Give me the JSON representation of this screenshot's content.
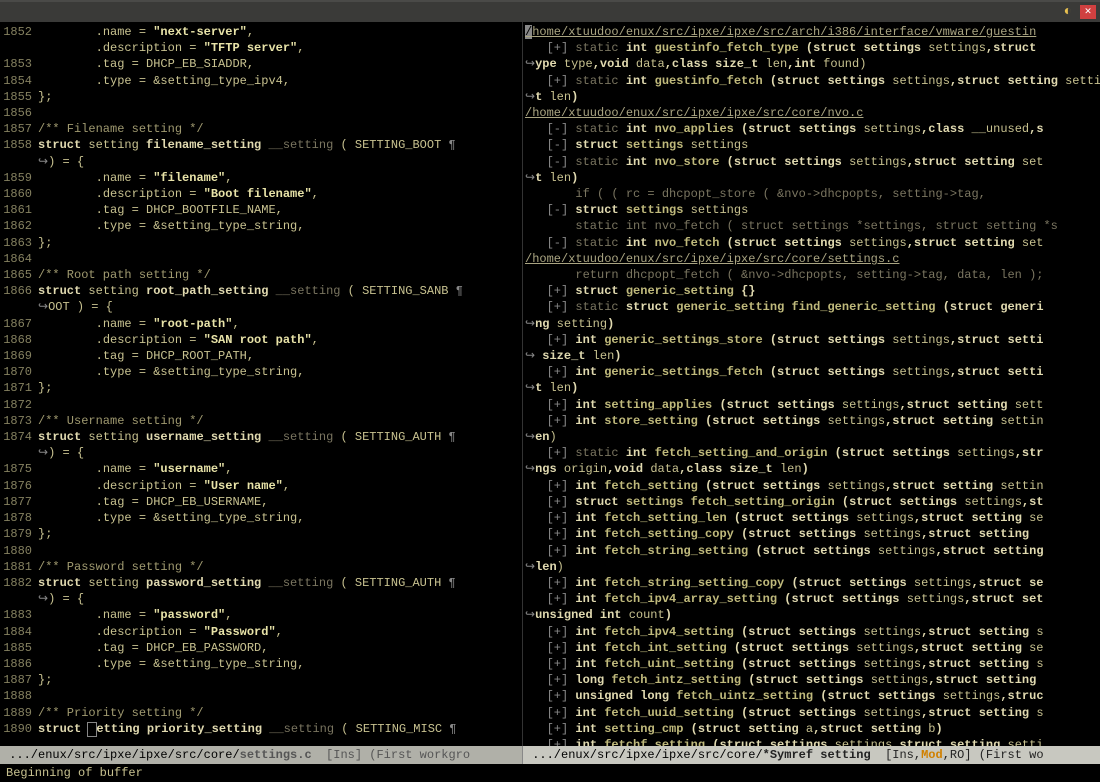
{
  "titlebar": {
    "collapse_glyph": "◐",
    "close_glyph": "✕"
  },
  "left": {
    "lines": [
      {
        "n": "1852",
        "pre": "        .",
        "f": "name",
        "eq": " = ",
        "s": "\"next-server\"",
        "t": ","
      },
      {
        "n": "",
        "pre": "        .",
        "f": "description",
        "eq": " = ",
        "s": "\"TFTP server\"",
        "t": ","
      },
      {
        "n": "1853",
        "pre": "        .",
        "f": "tag",
        "eq": " = DHCP_EB_SIADDR,",
        "s": "",
        "t": ""
      },
      {
        "n": "1854",
        "pre": "        .",
        "f": "type",
        "eq": " = &setting_type_ipv4,",
        "s": "",
        "t": ""
      },
      {
        "n": "1855",
        "pre": "};",
        "f": "",
        "eq": "",
        "s": "",
        "t": ""
      },
      {
        "n": "1856",
        "pre": "",
        "f": "",
        "eq": "",
        "s": "",
        "t": ""
      },
      {
        "n": "1857",
        "pre": "",
        "cm": "/** Filename setting */"
      },
      {
        "n": "1858",
        "struct": true,
        "name": "filename_setting",
        "attr": "__setting",
        "macro": "SETTING_BOOT",
        "wrap": true
      },
      {
        "n": "1859",
        "pre": "        .",
        "f": "name",
        "eq": " = ",
        "s": "\"filename\"",
        "t": ","
      },
      {
        "n": "1860",
        "pre": "        .",
        "f": "description",
        "eq": " = ",
        "s": "\"Boot filename\"",
        "t": ","
      },
      {
        "n": "1861",
        "pre": "        .",
        "f": "tag",
        "eq": " = DHCP_BOOTFILE_NAME,",
        "s": "",
        "t": ""
      },
      {
        "n": "1862",
        "pre": "        .",
        "f": "type",
        "eq": " = &setting_type_string,",
        "s": "",
        "t": ""
      },
      {
        "n": "1863",
        "pre": "};",
        "f": "",
        "eq": "",
        "s": "",
        "t": ""
      },
      {
        "n": "1864",
        "pre": "",
        "f": "",
        "eq": "",
        "s": "",
        "t": ""
      },
      {
        "n": "1865",
        "pre": "",
        "cm": "/** Root path setting */"
      },
      {
        "n": "1866",
        "struct": true,
        "name": "root_path_setting",
        "attr": "__setting",
        "macro": "SETTING_SANB",
        "wrap": true,
        "wrapText": "OOT ) = {"
      },
      {
        "n": "1867",
        "pre": "        .",
        "f": "name",
        "eq": " = ",
        "s": "\"root-path\"",
        "t": ","
      },
      {
        "n": "1868",
        "pre": "        .",
        "f": "description",
        "eq": " = ",
        "s": "\"SAN root path\"",
        "t": ","
      },
      {
        "n": "1869",
        "pre": "        .",
        "f": "tag",
        "eq": " = DHCP_ROOT_PATH,",
        "s": "",
        "t": ""
      },
      {
        "n": "1870",
        "pre": "        .",
        "f": "type",
        "eq": " = &setting_type_string,",
        "s": "",
        "t": ""
      },
      {
        "n": "1871",
        "pre": "};",
        "f": "",
        "eq": "",
        "s": "",
        "t": ""
      },
      {
        "n": "1872",
        "pre": "",
        "f": "",
        "eq": "",
        "s": "",
        "t": ""
      },
      {
        "n": "1873",
        "pre": "",
        "cm": "/** Username setting */"
      },
      {
        "n": "1874",
        "struct": true,
        "name": "username_setting",
        "attr": "__setting",
        "macro": "SETTING_AUTH",
        "wrap": true
      },
      {
        "n": "1875",
        "pre": "        .",
        "f": "name",
        "eq": " = ",
        "s": "\"username\"",
        "t": ","
      },
      {
        "n": "1876",
        "pre": "        .",
        "f": "description",
        "eq": " = ",
        "s": "\"User name\"",
        "t": ","
      },
      {
        "n": "1877",
        "pre": "        .",
        "f": "tag",
        "eq": " = DHCP_EB_USERNAME,",
        "s": "",
        "t": ""
      },
      {
        "n": "1878",
        "pre": "        .",
        "f": "type",
        "eq": " = &setting_type_string,",
        "s": "",
        "t": ""
      },
      {
        "n": "1879",
        "pre": "};",
        "f": "",
        "eq": "",
        "s": "",
        "t": ""
      },
      {
        "n": "1880",
        "pre": "",
        "f": "",
        "eq": "",
        "s": "",
        "t": ""
      },
      {
        "n": "1881",
        "pre": "",
        "cm": "/** Password setting */"
      },
      {
        "n": "1882",
        "struct": true,
        "name": "password_setting",
        "attr": "__setting",
        "macro": "SETTING_AUTH",
        "wrap": true
      },
      {
        "n": "1883",
        "pre": "        .",
        "f": "name",
        "eq": " = ",
        "s": "\"password\"",
        "t": ","
      },
      {
        "n": "1884",
        "pre": "        .",
        "f": "description",
        "eq": " = ",
        "s": "\"Password\"",
        "t": ","
      },
      {
        "n": "1885",
        "pre": "        .",
        "f": "tag",
        "eq": " = DHCP_EB_PASSWORD,",
        "s": "",
        "t": ""
      },
      {
        "n": "1886",
        "pre": "        .",
        "f": "type",
        "eq": " = &setting_type_string,",
        "s": "",
        "t": ""
      },
      {
        "n": "1887",
        "pre": "};",
        "f": "",
        "eq": "",
        "s": "",
        "t": ""
      },
      {
        "n": "1888",
        "pre": "",
        "f": "",
        "eq": "",
        "s": "",
        "t": ""
      },
      {
        "n": "1889",
        "pre": "",
        "cm": "/** Priority setting */"
      },
      {
        "n": "1890",
        "struct": true,
        "name": "priority_setting",
        "attr": "__setting",
        "macro": "SETTING_MISC",
        "wrap": false,
        "cursor": true
      }
    ]
  },
  "right": {
    "paths": [
      {
        "at": 0,
        "text": "/home/xtuudoo/enux/src/ipxe/ipxe/src/arch/i386/interface/vmware/guestin",
        "cursor": true
      },
      {
        "at": 5,
        "text": "/home/xtuudoo/enux/src/ipxe/ipxe/src/core/nvo.c"
      },
      {
        "at": 14,
        "text": "/home/xtuudoo/enux/src/ipxe/ipxe/src/core/settings.c"
      }
    ],
    "rows": [
      {
        "m": "[+]",
        "p": " static ",
        "k": "int",
        "fn": " guestinfo_fetch_type ",
        "a": "(struct settings ",
        "v": "settings",
        "a2": ",struct "
      },
      {
        "wrap": true,
        "p": "ype ",
        "v": "type",
        "p2": ",void ",
        "v2": "data",
        "p3": ",class size_t ",
        "v3": "len",
        "p4": ",int ",
        "v4": "found",
        "p5": ")"
      },
      {
        "m": "[+]",
        "p": " static ",
        "k": "int",
        "fn": " guestinfo_fetch ",
        "a": "(struct settings ",
        "v": "settings",
        "a2": ",struct setting ",
        "v2": "settin"
      },
      {
        "wrap": true,
        "p": "t ",
        "v": "len",
        "p2": ")"
      },
      {
        "m": "[-]",
        "p": " static ",
        "k": "int",
        "fn": " nvo_applies ",
        "a": "(struct settings ",
        "v": "settings",
        "a2": ",class ",
        "v2": "__unused",
        "a3": ",s"
      },
      {
        "m": "[-]",
        "p": " ",
        "k": "struct",
        "fn": " settings ",
        "v": "settings"
      },
      {
        "m": "[-]",
        "p": " static ",
        "k": "int",
        "fn": " nvo_store ",
        "a": "(struct settings ",
        "v": "settings",
        "a2": ",struct setting ",
        "v2": "set"
      },
      {
        "wrap": true,
        "p": "t ",
        "v": "len",
        "p2": ")"
      },
      {
        "plain": true,
        "text": "       if ( ( rc = dhcpopt_store ( &nvo->dhcpopts, setting->tag,"
      },
      {
        "m": "[-]",
        "p": " ",
        "k": "struct",
        "fn": " settings ",
        "v": "settings"
      },
      {
        "plain": true,
        "text": "       static int nvo_fetch ( struct settings *settings, struct setting *s"
      },
      {
        "m": "[-]",
        "p": " static ",
        "k": "int",
        "fn": " nvo_fetch ",
        "a": "(struct settings ",
        "v": "settings",
        "a2": ",struct setting ",
        "v2": "set"
      },
      {
        "plain": true,
        "text": "       return dhcpopt_fetch ( &nvo->dhcpopts, setting->tag, data, len );"
      },
      {
        "m": "[+]",
        "p": " ",
        "k": "struct",
        "fn": " generic_setting ",
        "a": "{}"
      },
      {
        "m": "[+]",
        "p": " static ",
        "k": "struct",
        "fn": " generic_setting ",
        "fn2": "find_generic_setting ",
        "a": "(struct generi"
      },
      {
        "wrap": true,
        "p": "ng ",
        "v": "setting",
        "p2": ")"
      },
      {
        "m": "[+]",
        "p": " ",
        "k": "int",
        "fn": " generic_settings_store ",
        "a": "(struct settings ",
        "v": "settings",
        "a2": ",struct setti"
      },
      {
        "wrap": true,
        "p": " size_t ",
        "v": "len",
        "p2": ")"
      },
      {
        "m": "[+]",
        "p": " ",
        "k": "int",
        "fn": " generic_settings_fetch ",
        "a": "(struct settings ",
        "v": "settings",
        "a2": ",struct setti"
      },
      {
        "wrap": true,
        "p": "t ",
        "v": "len",
        "p2": ")"
      },
      {
        "m": "[+]",
        "p": " ",
        "k": "int",
        "fn": " setting_applies ",
        "a": "(struct settings ",
        "v": "settings",
        "a2": ",struct setting ",
        "v2": "sett"
      },
      {
        "m": "[+]",
        "p": " ",
        "k": "int",
        "fn": " store_setting ",
        "a": "(struct settings ",
        "v": "settings",
        "a2": ",struct setting ",
        "v2": "settin"
      },
      {
        "wrap": true,
        "p": "en",
        ")": true
      },
      {
        "m": "[+]",
        "p": " static ",
        "k": "int",
        "fn": " fetch_setting_and_origin ",
        "a": "(struct settings ",
        "v": "settings",
        "a2": ",str"
      },
      {
        "wrap": true,
        "p": "ngs ",
        "v": "origin",
        "p2": ",void ",
        "v2": "data",
        "p3": ",class size_t ",
        "v3": "len",
        "p4": ")"
      },
      {
        "m": "[+]",
        "p": " ",
        "k": "int",
        "fn": " fetch_setting ",
        "a": "(struct settings ",
        "v": "settings",
        "a2": ",struct setting ",
        "v2": "settin"
      },
      {
        "m": "[+]",
        "p": " ",
        "k": "struct",
        "fn": " settings ",
        "fn2": "fetch_setting_origin ",
        "a": "(struct settings ",
        "v": "settings",
        "a2": ",st"
      },
      {
        "m": "[+]",
        "p": " ",
        "k": "int",
        "fn": " fetch_setting_len ",
        "a": "(struct settings ",
        "v": "settings",
        "a2": ",struct setting ",
        "v2": "se"
      },
      {
        "m": "[+]",
        "p": " ",
        "k": "int",
        "fn": " fetch_setting_copy ",
        "a": "(struct settings ",
        "v": "settings",
        "a2": ",struct setting "
      },
      {
        "m": "[+]",
        "p": " ",
        "k": "int",
        "fn": " fetch_string_setting ",
        "a": "(struct settings ",
        "v": "settings",
        "a2": ",struct setting"
      },
      {
        "wrap": true,
        "p": "len",
        ")": true
      },
      {
        "m": "[+]",
        "p": " ",
        "k": "int",
        "fn": " fetch_string_setting_copy ",
        "a": "(struct settings ",
        "v": "settings",
        "a2": ",struct se"
      },
      {
        "m": "[+]",
        "p": " ",
        "k": "int",
        "fn": " fetch_ipv4_array_setting ",
        "a": "(struct settings ",
        "v": "settings",
        "a2": ",struct set"
      },
      {
        "wrap": true,
        "p": "unsigned int ",
        "v": "count",
        "p2": ")"
      },
      {
        "m": "[+]",
        "p": " ",
        "k": "int",
        "fn": " fetch_ipv4_setting ",
        "a": "(struct settings ",
        "v": "settings",
        "a2": ",struct setting ",
        "v2": "s"
      },
      {
        "m": "[+]",
        "p": " ",
        "k": "int",
        "fn": " fetch_int_setting ",
        "a": "(struct settings ",
        "v": "settings",
        "a2": ",struct setting ",
        "v2": "se"
      },
      {
        "m": "[+]",
        "p": " ",
        "k": "int",
        "fn": " fetch_uint_setting ",
        "a": "(struct settings ",
        "v": "settings",
        "a2": ",struct setting ",
        "v2": "s"
      },
      {
        "m": "[+]",
        "p": " ",
        "k": "long",
        "fn": " fetch_intz_setting ",
        "a": "(struct settings ",
        "v": "settings",
        "a2": ",struct setting "
      },
      {
        "m": "[+]",
        "p": " ",
        "k": "unsigned long",
        "fn": " fetch_uintz_setting ",
        "a": "(struct settings ",
        "v": "settings",
        "a2": ",struc"
      },
      {
        "m": "[+]",
        "p": " ",
        "k": "int",
        "fn": " fetch_uuid_setting ",
        "a": "(struct settings ",
        "v": "settings",
        "a2": ",struct setting ",
        "v2": "s"
      },
      {
        "m": "[+]",
        "p": " ",
        "k": "int",
        "fn": " setting_cmp ",
        "a": "(struct setting ",
        "v": "a",
        "a2": ",struct setting ",
        "v2": "b",
        "a3": ")"
      },
      {
        "m": "[+]",
        "p": " ",
        "k": "int",
        "fn": " fetchf_setting ",
        "a": "(struct settings ",
        "v": "settings",
        "a2": ",struct setting ",
        "v2": "setti"
      }
    ]
  },
  "modeline_left": {
    "prefix": " .../enux/src/ipxe/ipxe/src/core/",
    "file": "settings.c",
    "suffix": "  [Ins] (First workgro"
  },
  "modeline_right": {
    "prefix": " .../enux/src/ipxe/ipxe/src/core/",
    "file": "*Symref setting",
    "mid": "  [Ins,",
    "mod": "Mod",
    "suffix": ",RO] (First wo"
  },
  "minibuffer": "Beginning of buffer"
}
